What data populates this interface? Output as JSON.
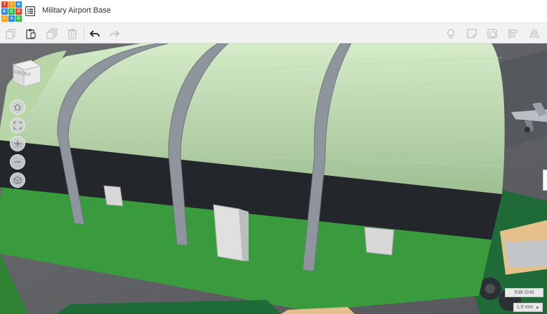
{
  "logo": {
    "letters": [
      "T",
      "I",
      "N",
      "K",
      "E",
      "R",
      "C",
      "A",
      "D"
    ],
    "colors": [
      "#e2412f",
      "#f5a11b",
      "#2b8ad9",
      "#2b8ad9",
      "#39b54a",
      "#e2412f",
      "#f5a11b",
      "#2b8ad9",
      "#39b54a"
    ]
  },
  "header": {
    "title": "Military Airport Base",
    "list_icon": "design-list-icon"
  },
  "toolbar": {
    "left_icons": [
      "copy-icon",
      "paste-icon",
      "duplicate-icon",
      "delete-icon",
      "undo-icon",
      "redo-icon"
    ],
    "right_icons": [
      "light-bulb-icon",
      "note-icon",
      "shape-icon",
      "align-icon",
      "mirror-icon"
    ]
  },
  "viewcube": {
    "label": "FRONT"
  },
  "view_controls": [
    "home-view-icon",
    "fit-view-icon",
    "zoom-in-icon",
    "zoom-out-icon",
    "perspective-icon"
  ],
  "grid": {
    "edit_label": "Edit Grid",
    "snap_value": "1.0 mm"
  },
  "colors": {
    "roof": "#c7e1b8",
    "ribs": "#8e959c",
    "wall": "#3a9a3e",
    "band": "#23262a",
    "floor": "#5e6063"
  }
}
